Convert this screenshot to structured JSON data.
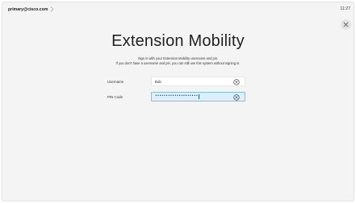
{
  "topbar": {
    "user_label": "primary@cisco.com",
    "user_chevron_icon": "chevron-right-icon",
    "time": "11:27"
  },
  "close_icon": "close-icon",
  "dialog": {
    "title": "Extension Mobility",
    "description_line_1": "Sign in with your Extension Mobility username and pin.",
    "description_line_2": "If you don't have a username and pin, you can still use this system without signing in."
  },
  "form": {
    "username": {
      "label": "Username",
      "value": "Bob",
      "clear_icon": "clear-icon"
    },
    "pin": {
      "label": "PIN Code",
      "masked_value": "••••••••••••••••••••",
      "clear_icon": "clear-icon",
      "focused": true
    }
  },
  "colors": {
    "background": "#f4f4f4",
    "focused_field_background": "#dcefff",
    "focused_field_border": "#7fc0ee",
    "clear_icon": "#2b2b2b"
  }
}
